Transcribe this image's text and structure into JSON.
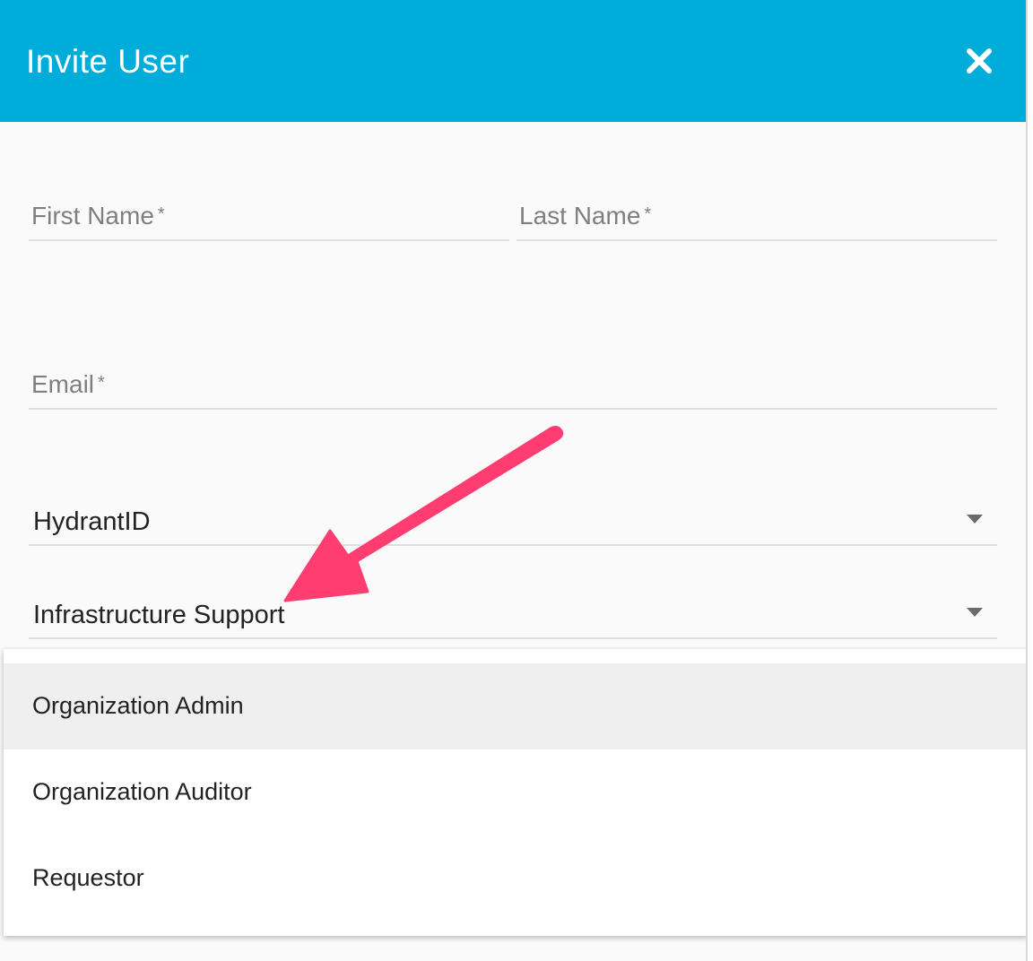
{
  "dialog": {
    "title": "Invite User",
    "close_icon": "close-icon"
  },
  "form": {
    "first_name_label": "First Name",
    "last_name_label": "Last Name",
    "email_label": "Email",
    "required_mark": "*",
    "identity_provider_value": "HydrantID",
    "role_value": "Infrastructure Support"
  },
  "role_menu": {
    "options": [
      "Organization Admin",
      "Organization Auditor",
      "Requestor"
    ],
    "highlighted_index": 0
  },
  "annotation": {
    "arrow_color": "#ff3d71",
    "accent_color": "#00acd9"
  }
}
